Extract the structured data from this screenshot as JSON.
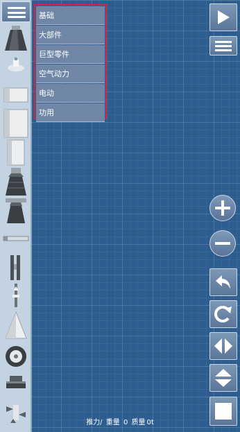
{
  "categories": [
    "基础",
    "大部件",
    "巨型零件",
    "空气动力",
    "电动",
    "功用"
  ],
  "status": {
    "thrust_label": "推力/",
    "weight_label": "重量",
    "weight_value": "0",
    "mass_label": "质量",
    "mass_value": "0t"
  },
  "icons": {
    "menu": "hamburger-icon",
    "play": "play-icon",
    "list": "list-icon",
    "zoom_in": "plus-icon",
    "zoom_out": "minus-icon",
    "undo": "undo-icon",
    "redo": "redo-icon",
    "flip_h": "flip-horizontal-icon",
    "flip_v": "flip-vertical-icon",
    "square": "square-icon"
  },
  "colors": {
    "background": "#2d5d8f",
    "panel": "#c3d3e2",
    "menu_highlight": "#d3263a",
    "button": "#6f86a7"
  }
}
